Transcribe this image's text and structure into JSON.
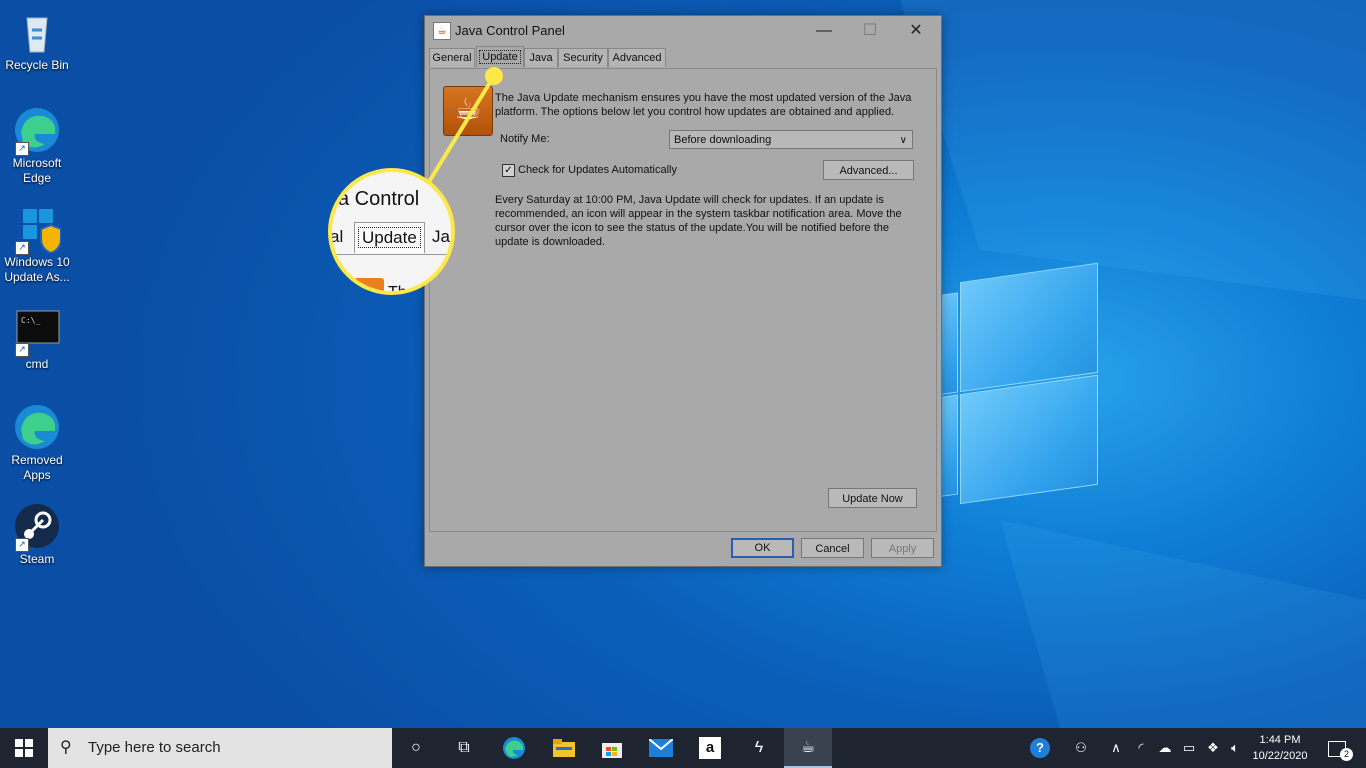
{
  "desktop_icons": [
    {
      "label": "Recycle Bin",
      "icon": "recycle-bin-icon"
    },
    {
      "label": "Microsoft Edge",
      "icon": "edge-icon"
    },
    {
      "label": "Windows 10 Update As...",
      "icon": "windows-update-icon"
    },
    {
      "label": "cmd",
      "icon": "cmd-icon"
    },
    {
      "label": "Removed Apps",
      "icon": "edge-icon"
    },
    {
      "label": "Steam",
      "icon": "steam-icon"
    }
  ],
  "window": {
    "title": "Java Control Panel",
    "tabs": [
      "General",
      "Update",
      "Java",
      "Security",
      "Advanced"
    ],
    "active_tab": "Update",
    "description": "The Java Update mechanism ensures you have the most updated version of the Java platform. The options below let you control how updates are obtained and applied.",
    "notify_label": "Notify Me:",
    "notify_value": "Before downloading",
    "auto_check_label": "Check for Updates Automatically",
    "auto_check_checked": true,
    "advanced_button": "Advanced...",
    "schedule_text": "Every Saturday at 10:00 PM, Java Update will check for updates. If an update is recommended, an icon will appear in the system taskbar notification area. Move the cursor over the icon to see the status of the update.You will be notified before the update is downloaded.",
    "update_now_button": "Update Now",
    "ok_button": "OK",
    "cancel_button": "Cancel",
    "apply_button": "Apply"
  },
  "callout": {
    "title_fragment": "a Control",
    "tab_left": "al",
    "tab_active": "Update",
    "tab_right": "Ja",
    "text_fragment": "Th",
    "highlight_color": "#fde84a"
  },
  "taskbar": {
    "search_placeholder": "Type here to search",
    "pinned": [
      "cortana-icon",
      "task-view-icon",
      "edge-icon",
      "file-explorer-icon",
      "store-icon",
      "mail-icon",
      "amazon-icon",
      "app-icon",
      "java-icon"
    ],
    "time": "1:44 PM",
    "date": "10/22/2020",
    "notification_count": "2"
  }
}
